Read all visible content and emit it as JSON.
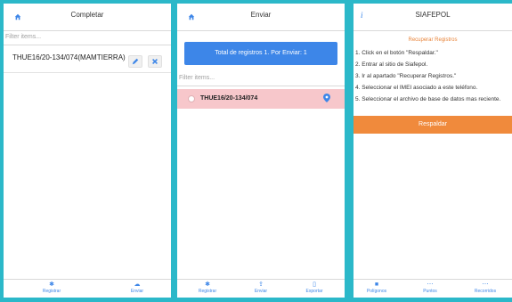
{
  "screens": {
    "completar": {
      "title": "Completar",
      "filter_placeholder": "Filter items...",
      "items": [
        {
          "label": "THUE16/20-134/074(MAMTIERRA)"
        }
      ],
      "nav": [
        {
          "label": "Registrar"
        },
        {
          "label": "Enviar"
        }
      ]
    },
    "enviar": {
      "title": "Enviar",
      "send_button": "Total de registros 1. Por Enviar: 1",
      "filter_placeholder": "Filter items...",
      "items": [
        {
          "label": "THUE16/20-134/074"
        }
      ],
      "nav": [
        {
          "label": "Registrar"
        },
        {
          "label": "Enviar"
        },
        {
          "label": "Exportar"
        }
      ]
    },
    "siafepol": {
      "title": "SIAFEPOL",
      "subtitle": "Recuperar Registros",
      "steps": [
        "1. Click en el botón \"Respaldar.\"",
        "2. Entrar al sitio de Siafepol.",
        "3. Ir al apartado \"Recuperar Registros.\"",
        "4. Seleccionar el IMEI asociado a este teléfono.",
        "5. Seleccionar el archivo de base de datos mas reciente."
      ],
      "button": "Respaldar",
      "nav": [
        {
          "label": "Polígonos"
        },
        {
          "label": "Puntos"
        },
        {
          "label": "Recorridos"
        }
      ]
    }
  },
  "colors": {
    "background": "#2bb8c9",
    "primary_blue": "#3d86e8",
    "accent_orange": "#f08a3c",
    "selected_row": "#f7c7cb"
  }
}
